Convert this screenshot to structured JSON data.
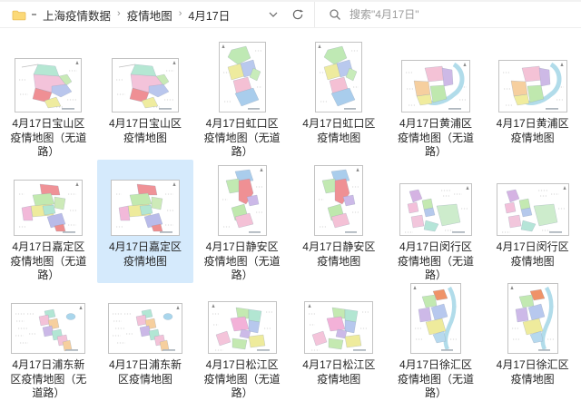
{
  "toolbar": {
    "breadcrumb": {
      "items": [
        "上海疫情数据",
        "疫情地图",
        "4月17日"
      ],
      "separator": "›"
    },
    "icons": {
      "address_folder": "folder-icon",
      "address_dropdown": "chevron-down-icon",
      "refresh": "refresh-icon",
      "search": "magnifier-icon"
    },
    "search_placeholder": "搜索\"4月17日\""
  },
  "content": {
    "selection_color": "#d5eafc",
    "items": [
      {
        "label": "4月17日宝山区疫情地图（无道路）",
        "district": "baoshan",
        "selected": false
      },
      {
        "label": "4月17日宝山区疫情地图",
        "district": "baoshan",
        "selected": false
      },
      {
        "label": "4月17日虹口区疫情地图（无道路）",
        "district": "hongkou",
        "selected": false
      },
      {
        "label": "4月17日虹口区疫情地图",
        "district": "hongkou",
        "selected": false
      },
      {
        "label": "4月17日黄浦区疫情地图（无道路）",
        "district": "huangpu",
        "selected": false
      },
      {
        "label": "4月17日黄浦区疫情地图",
        "district": "huangpu",
        "selected": false
      },
      {
        "label": "4月17日嘉定区疫情地图（无道路）",
        "district": "jiading",
        "selected": false
      },
      {
        "label": "4月17日嘉定区疫情地图",
        "district": "jiading",
        "selected": true
      },
      {
        "label": "4月17日静安区疫情地图（无道路）",
        "district": "jingan",
        "selected": false
      },
      {
        "label": "4月17日静安区疫情地图",
        "district": "jingan",
        "selected": false
      },
      {
        "label": "4月17日闵行区疫情地图（无道路）",
        "district": "minhang",
        "selected": false
      },
      {
        "label": "4月17日闵行区疫情地图",
        "district": "minhang",
        "selected": false
      },
      {
        "label": "4月17日浦东新区疫情地图（无道路）",
        "district": "pudong",
        "selected": false
      },
      {
        "label": "4月17日浦东新区疫情地图",
        "district": "pudong",
        "selected": false
      },
      {
        "label": "4月17日松江区疫情地图（无道路）",
        "district": "songjiang",
        "selected": false
      },
      {
        "label": "4月17日松江区疫情地图",
        "district": "songjiang",
        "selected": false
      },
      {
        "label": "4月17日徐汇区疫情地图（无道路）",
        "district": "xuhui",
        "selected": false
      },
      {
        "label": "4月17日徐汇区疫情地图",
        "district": "xuhui",
        "selected": false
      }
    ]
  }
}
